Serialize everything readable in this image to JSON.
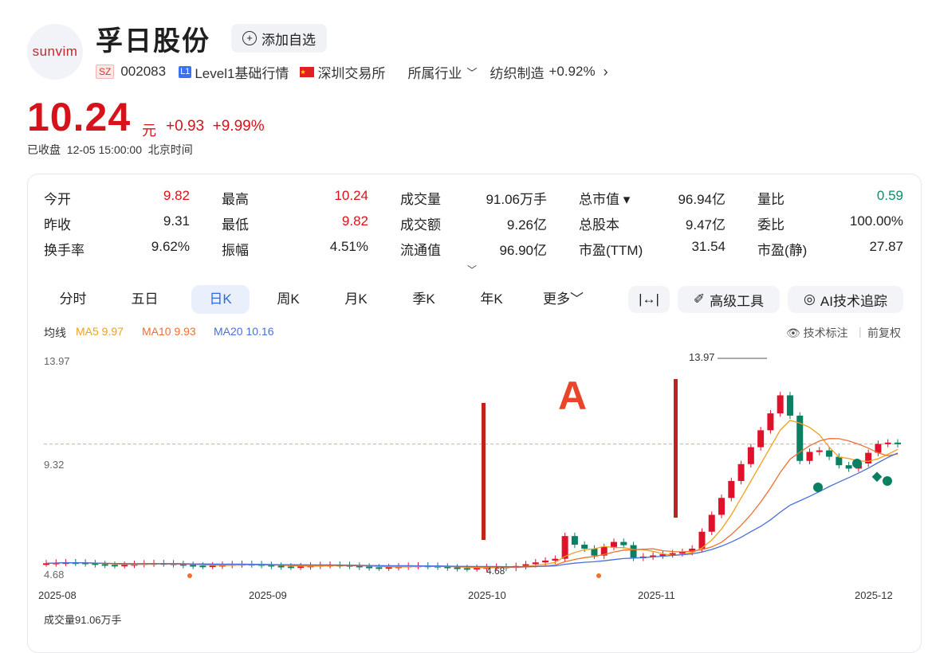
{
  "stock": {
    "logo_text": "sunvim",
    "name": "孚日股份",
    "watch_label": "添加自选",
    "exchange_tag": "SZ",
    "code": "002083",
    "level_tag": "L1",
    "level_label": "Level1基础行情",
    "exchange": "深圳交易所",
    "industry_label": "所属行业",
    "industry_name": "纺织制造",
    "industry_change": "+0.92%",
    "price": "10.24",
    "unit": "元",
    "change": "+0.93",
    "change_pct": "+9.99%",
    "status": "已收盘",
    "timestamp": "12-05 15:00:00",
    "timezone": "北京时间"
  },
  "stats": [
    {
      "label": "今开",
      "value": "9.82",
      "color": "red"
    },
    {
      "label": "最高",
      "value": "10.24",
      "color": "red"
    },
    {
      "label": "成交量",
      "value": "91.06万手",
      "color": "dark"
    },
    {
      "label": "总市值",
      "value": "96.94亿",
      "color": "dark"
    },
    {
      "label": "量比",
      "value": "0.59",
      "color": "green"
    },
    {
      "label": "昨收",
      "value": "9.31",
      "color": "dark"
    },
    {
      "label": "最低",
      "value": "9.82",
      "color": "red"
    },
    {
      "label": "成交额",
      "value": "9.26亿",
      "color": "dark"
    },
    {
      "label": "总股本",
      "value": "9.47亿",
      "color": "dark"
    },
    {
      "label": "委比",
      "value": "100.00%",
      "color": "dark"
    },
    {
      "label": "换手率",
      "value": "9.62%",
      "color": "dark"
    },
    {
      "label": "振幅",
      "value": "4.51%",
      "color": "dark"
    },
    {
      "label": "流通值",
      "value": "96.90亿",
      "color": "dark"
    },
    {
      "label": "市盈(TTM)",
      "value": "31.54",
      "color": "dark"
    },
    {
      "label": "市盈(静)",
      "value": "27.87",
      "color": "dark"
    }
  ],
  "tabs": [
    "分时",
    "五日",
    "日K",
    "周K",
    "月K",
    "季K",
    "年K",
    "更多"
  ],
  "active_tab": "日K",
  "tools": {
    "advanced": "高级工具",
    "ai": "AI技术追踪"
  },
  "ma": {
    "label": "均线",
    "ma5": "MA5 9.97",
    "ma10": "MA10 9.93",
    "ma20": "MA20 10.16"
  },
  "chart_options": {
    "tech": "技术标注",
    "adjust": "前复权"
  },
  "chart_data": {
    "type": "candlestick",
    "ylim": [
      4.68,
      13.97
    ],
    "y_tick_labels": [
      "13.97",
      "9.32",
      "4.68"
    ],
    "x_tick_labels": [
      "2025-08",
      "2025-09",
      "2025-10",
      "2025-11",
      "2025-12"
    ],
    "annotations": {
      "high": "13.97",
      "low": "4.68",
      "marker": "A"
    },
    "current_price": 10.24,
    "volume_label": "成交量91.06万手",
    "colors": {
      "up": "#e0112b",
      "down": "#0a7f62",
      "ma5": "#f0a020",
      "ma10": "#f07030",
      "ma20": "#4a6fe0"
    }
  }
}
